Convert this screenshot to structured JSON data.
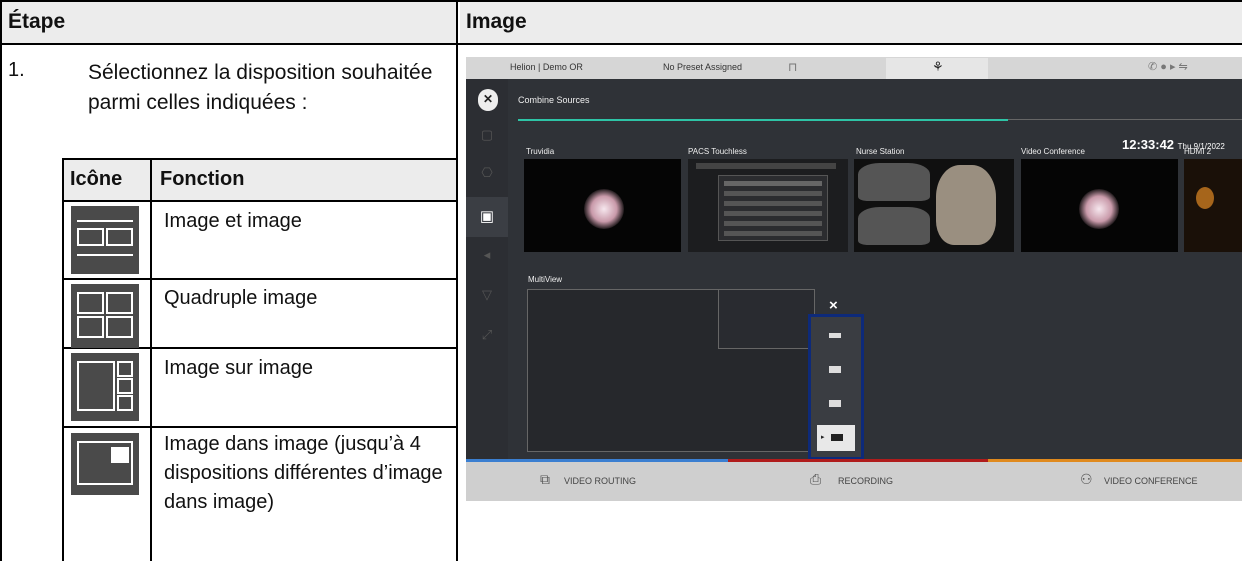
{
  "table": {
    "headers": {
      "step": "Étape",
      "image": "Image"
    },
    "step_number": "1.",
    "step_text": "Sélectionnez la disposition souhaitée parmi celles indiquées :",
    "inner_headers": {
      "icon": "Icône",
      "function": "Fonction"
    },
    "rows": [
      {
        "icon": "side-by-side-icon",
        "function": "Image et image"
      },
      {
        "icon": "quad-icon",
        "function": "Quadruple image"
      },
      {
        "icon": "picture-over-picture-icon",
        "function": "Image sur image"
      },
      {
        "icon": "picture-in-picture-icon",
        "function": "Image dans image (jusqu’à 4 dispositions différentes d’image dans image)"
      }
    ]
  },
  "screenshot": {
    "top_bar": {
      "location": "Helion | Demo OR",
      "preset": "No Preset Assigned"
    },
    "panel_title": "Combine Sources",
    "clock": {
      "time": "12:33:42",
      "date": "Thu 9/1/2022"
    },
    "sources": [
      "Truvidia",
      "PACS Touchless",
      "Nurse Station",
      "Video Conference",
      "HDMI 2"
    ],
    "multiview_label": "MultiView",
    "close_glyph": "×",
    "bottom_tabs": [
      {
        "label": "VIDEO ROUTING",
        "color": "#3b7fd1"
      },
      {
        "label": "RECORDING",
        "color": "#b01c1c"
      },
      {
        "label": "VIDEO CONFERENCE",
        "color": "#e08a1e"
      }
    ]
  }
}
